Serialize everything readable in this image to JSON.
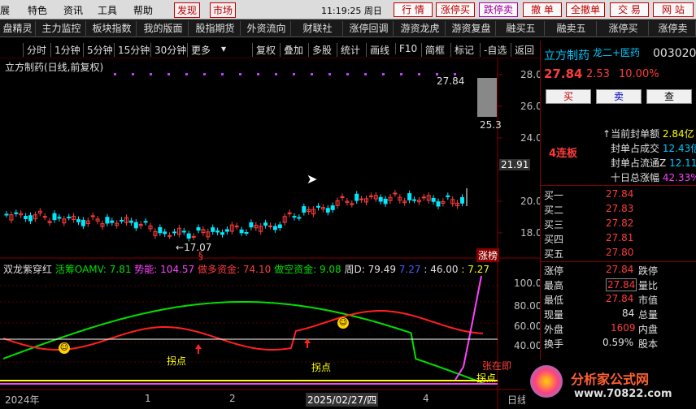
{
  "menubar": {
    "items": [
      "展",
      "特色",
      "资讯",
      "工具",
      "帮助"
    ],
    "red_items": [
      "发现",
      "市场"
    ],
    "clock": "11:19:25 周日",
    "right_buttons": [
      "行 情",
      "涨停买",
      "跌停卖",
      "撤 单",
      "全撤单",
      "交 易",
      "网 站"
    ]
  },
  "toolbar": {
    "items": [
      "盘精灵",
      "主力监控",
      "板块指数",
      "我的版面",
      "股指期货",
      "外资流向",
      "财联社",
      "涨停回调",
      "游资龙虎",
      "游资复盘",
      "融买五",
      "融卖五",
      "涨停买",
      "涨停卖"
    ]
  },
  "periodbar": {
    "items": [
      "分时",
      "1分钟",
      "5分钟",
      "15分钟",
      "30分钟",
      "更多"
    ],
    "right_items": [
      "复权",
      "叠加",
      "多股",
      "统计",
      "画线",
      "F10",
      "简框",
      "标记",
      "-自选",
      "返回"
    ]
  },
  "main_chart": {
    "title": "立方制药(日线,前复权)",
    "high_label": "27.84",
    "low_label": "17.07",
    "price_25": "25.3",
    "price_21": "21.91",
    "tag": "涨榜",
    "y_ticks": [
      "28.00",
      "26.00",
      "24.00",
      "22.00",
      "20.00",
      "18.00"
    ],
    "marker": "§"
  },
  "indicator": {
    "name": "双龙紫穿红",
    "oamv_label": "活筹OAMV:",
    "oamv_value": "7.81",
    "shineng_label": "势能:",
    "shineng_value": "104.57",
    "duo_label": "做多资金:",
    "duo_value": "74.10",
    "kong_label": "做空资金:",
    "kong_value": "9.08",
    "zhou_label": "周D:",
    "zhou_value": "79.49",
    "v1": "7.27",
    "v2": ": 46.00",
    "v3": ": 7.27",
    "y_ticks": [
      "100.00",
      "80.00",
      "60.00",
      "40.00",
      "20.00"
    ],
    "ann1": "拐点",
    "ann2": "拐点",
    "ann3": "张在即",
    "ann4": "拐点"
  },
  "xaxis": {
    "labels": [
      "2024年",
      "1",
      "2",
      "2025/02/27/四",
      "4"
    ],
    "right": "日线"
  },
  "right_panel": {
    "name": "立方制药",
    "tag": "龙二+医药",
    "code": "003020",
    "price": "27.84",
    "change": "2.53",
    "pct": "10.00%",
    "buy_btn": "买",
    "sell_btn": "卖",
    "check_btn": "查",
    "lianban": "4连板",
    "stats": [
      {
        "label": "当前封单额",
        "value": "2.84亿"
      },
      {
        "label": "封单占成交",
        "value": "12.43倍"
      },
      {
        "label": "封单占流通Z",
        "value": "12.11"
      },
      {
        "label": "十日总涨幅",
        "value": "42.33%"
      }
    ],
    "buys": [
      {
        "label": "买一",
        "price": "27.84"
      },
      {
        "label": "买二",
        "price": "27.83"
      },
      {
        "label": "买三",
        "price": "27.82"
      },
      {
        "label": "买四",
        "price": "27.81"
      },
      {
        "label": "买五",
        "price": "27.80"
      }
    ],
    "quote": [
      {
        "l1": "涨停",
        "v1": "27.84",
        "l2": "跌停"
      },
      {
        "l1": "最高",
        "v1": "27.84",
        "l2": "量比"
      },
      {
        "l1": "最低",
        "v1": "27.84",
        "l2": "市值"
      },
      {
        "l1": "现量",
        "v1": "84",
        "l2": "总量"
      },
      {
        "l1": "外盘",
        "v1": "1609",
        "l2": "内盘"
      },
      {
        "l1": "换手",
        "v1": "0.59%",
        "l2": "股本"
      }
    ],
    "logo_text": "分析家公式网",
    "logo_url": "www.70822.com"
  }
}
